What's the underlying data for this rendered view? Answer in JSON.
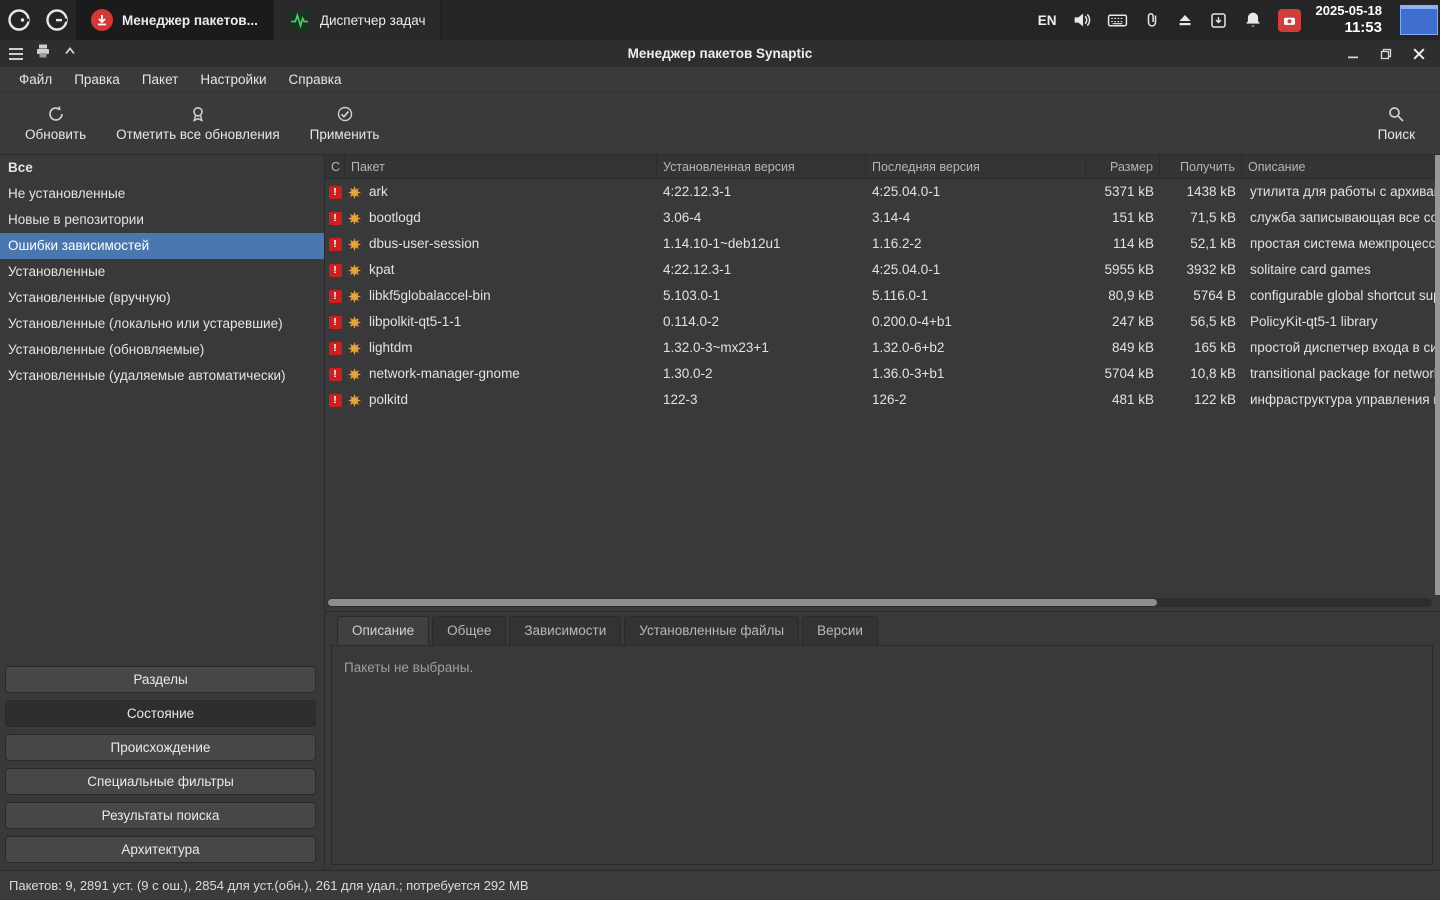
{
  "colors": {
    "selection_blue": "#4a77ad",
    "broken_red": "#cc2020",
    "package_orange": "#e8a33c"
  },
  "taskbar": {
    "windows": [
      {
        "label": "Менеджер пакетов...",
        "active": true
      },
      {
        "label": "Диспетчер задач",
        "active": false
      }
    ],
    "tray": {
      "language": "EN",
      "date": "2025-05-18",
      "time": "11:53"
    }
  },
  "window": {
    "title": "Менеджер пакетов Synaptic",
    "menu": [
      "Файл",
      "Правка",
      "Пакет",
      "Настройки",
      "Справка"
    ],
    "toolbar": {
      "reload": "Обновить",
      "mark_all": "Отметить все обновления",
      "apply": "Применить",
      "search": "Поиск"
    },
    "sidebar": {
      "filters": [
        {
          "label": "Все",
          "bold": true
        },
        {
          "label": "Не установленные"
        },
        {
          "label": "Новые в репозитории"
        },
        {
          "label": "Ошибки зависимостей",
          "selected": true
        },
        {
          "label": "Установленные"
        },
        {
          "label": "Установленные (вручную)"
        },
        {
          "label": "Установленные (локально или устаревшие)"
        },
        {
          "label": "Установленные (обновляемые)"
        },
        {
          "label": "Установленные (удаляемые автоматически)"
        }
      ],
      "buttons": [
        {
          "label": "Разделы"
        },
        {
          "label": "Состояние",
          "active": true
        },
        {
          "label": "Происхождение"
        },
        {
          "label": "Специальные фильтры"
        },
        {
          "label": "Результаты поиска"
        },
        {
          "label": "Архитектура"
        }
      ]
    },
    "table": {
      "columns": [
        "С",
        "Пакет",
        "Установленная версия",
        "Последняя версия",
        "Размер",
        "Получить",
        "Описание"
      ],
      "rows": [
        {
          "package": "ark",
          "installed": "4:22.12.3-1",
          "latest": "4:25.04.0-1",
          "size": "5371 kB",
          "download": "1438 kB",
          "description": "утилита для работы с архивами"
        },
        {
          "package": "bootlogd",
          "installed": "3.06-4",
          "latest": "3.14-4",
          "size": "151 kB",
          "download": "71,5 kB",
          "description": "служба записывающая все сообщения"
        },
        {
          "package": "dbus-user-session",
          "installed": "1.14.10-1~deb12u1",
          "latest": "1.16.2-2",
          "size": "114 kB",
          "download": "52,1 kB",
          "description": "простая система межпроцессного взаимодействия"
        },
        {
          "package": "kpat",
          "installed": "4:22.12.3-1",
          "latest": "4:25.04.0-1",
          "size": "5955 kB",
          "download": "3932 kB",
          "description": "solitaire card games"
        },
        {
          "package": "libkf5globalaccel-bin",
          "installed": "5.103.0-1",
          "latest": "5.116.0-1",
          "size": "80,9 kB",
          "download": "5764  B",
          "description": "configurable global shortcut support"
        },
        {
          "package": "libpolkit-qt5-1-1",
          "installed": "0.114.0-2",
          "latest": "0.200.0-4+b1",
          "size": "247 kB",
          "download": "56,5 kB",
          "description": "PolicyKit-qt5-1 library"
        },
        {
          "package": "lightdm",
          "installed": "1.32.0-3~mx23+1",
          "latest": "1.32.0-6+b2",
          "size": "849 kB",
          "download": "165 kB",
          "description": "простой диспетчер входа в систему"
        },
        {
          "package": "network-manager-gnome",
          "installed": "1.30.0-2",
          "latest": "1.36.0-3+b1",
          "size": "5704 kB",
          "download": "10,8 kB",
          "description": "transitional package for network-manager"
        },
        {
          "package": "polkitd",
          "installed": "122-3",
          "latest": "126-2",
          "size": "481 kB",
          "download": "122 kB",
          "description": "инфраструктура управления политиками"
        }
      ]
    },
    "tabs": [
      {
        "label": "Описание",
        "active": true
      },
      {
        "label": "Общее"
      },
      {
        "label": "Зависимости"
      },
      {
        "label": "Установленные файлы"
      },
      {
        "label": "Версии"
      }
    ],
    "details_placeholder": "Пакеты не выбраны.",
    "statusbar": "Пакетов: 9, 2891 уст. (9 с ош.), 2854 для уст.(обн.), 261 для удал.; потребуется 292 MB"
  }
}
